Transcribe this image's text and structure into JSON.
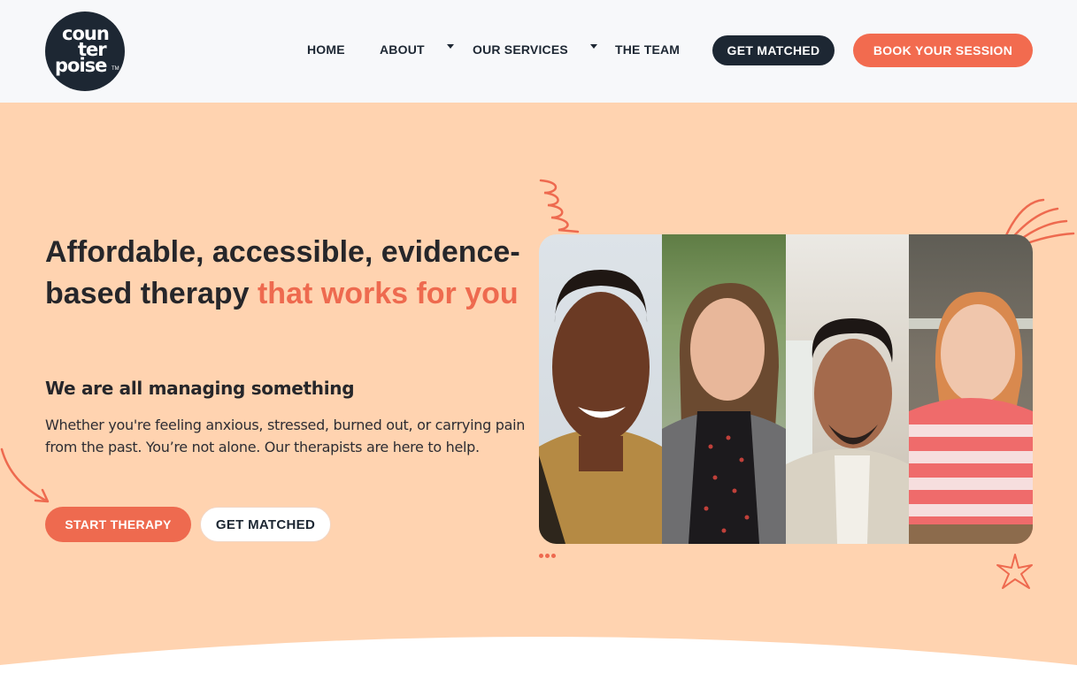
{
  "header": {
    "logo": {
      "line1": "coun",
      "line2": "ter",
      "line3": "poise",
      "tm": "TM"
    },
    "nav": [
      {
        "label": "HOME"
      },
      {
        "label": "ABOUT"
      },
      {
        "label": "OUR SERVICES"
      },
      {
        "label": "THE TEAM"
      }
    ],
    "get_matched": "GET MATCHED",
    "book_session": "BOOK YOUR SESSION"
  },
  "hero": {
    "headline_part1": "Affordable, accessible, evidence-based therapy ",
    "headline_accent": "that works for you",
    "subheading": "We are all managing something",
    "paragraph": "Whether you're feeling anxious, stressed, burned out, or carrying pain from the past. You’re not alone. Our therapists are here to help.",
    "start_therapy": "START THERAPY",
    "get_matched": "GET MATCHED"
  },
  "colors": {
    "navy": "#1d2733",
    "orange": "#f26b4f",
    "peach": "#ffd3b0",
    "header_bg": "#f7f8fa"
  },
  "icons": [
    "spiral-doodle-icon",
    "lines-doodle-icon",
    "star-doodle-icon",
    "arrow-doodle-icon",
    "dropdown-caret-icon"
  ]
}
